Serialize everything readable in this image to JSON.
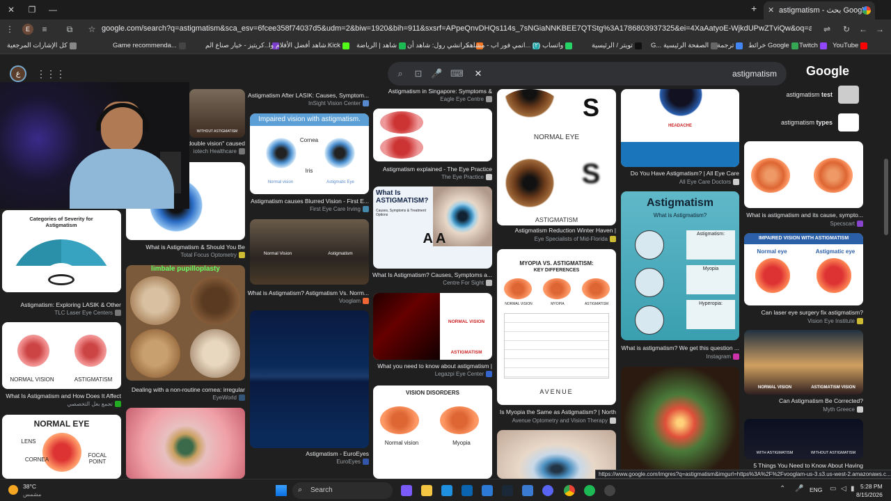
{
  "window": {
    "minimize": "—",
    "restore": "❐",
    "close": "✕"
  },
  "tab": {
    "title": "astigmatism - بحث Google",
    "close": "✕",
    "newtab": "+"
  },
  "toolbar": {
    "url": "google.com/search?q=astigmatism&sca_esv=6fcee358f74037d5&udm=2&biw=1920&bih=911&sxsrf=APpeQnvDHQs114s_7sNGiaNNKBEE7QTStg%3A1786803937325&ei=4XaAatyoE-WjkdUPwZTviQw&oq=asti&gs_lp=Egtnd3MtdGl6LWltZyIEYXN0aSo...",
    "profile": "E"
  },
  "bookmarks": [
    {
      "label": "كل الإشارات المرجعية",
      "color": "#888"
    },
    {
      "label": "Game recommenda...",
      "color": "#444"
    },
    {
      "label": "كريتيز - خيار صناع الم...",
      "color": "#7a3cc9"
    },
    {
      "label": "شاهد أفضل الأفلام وا...",
      "color": "#333"
    },
    {
      "label": "Kick",
      "color": "#53fc18"
    },
    {
      "label": "شاهد | الرياضة",
      "color": "#1db954"
    },
    {
      "label": "كرانشي رول: شاهد أن...",
      "color": "#f47521"
    },
    {
      "label": "انمي فور اب - مشاهد...",
      "color": "#2aa"
    },
    {
      "label": "واتساب (٢)",
      "color": "#25d366"
    },
    {
      "label": "تويتر / الرئيسية",
      "color": "#111"
    },
    {
      "label": "G... الصفحة الرئيسية",
      "color": "#666"
    },
    {
      "label": "ترجمة",
      "color": "#4285f4"
    },
    {
      "label": "خرائط Google",
      "color": "#34a853"
    },
    {
      "label": "Twitch",
      "color": "#9146ff"
    },
    {
      "label": "YouTube",
      "color": "#ff0000"
    }
  ],
  "search": {
    "query": "astigmatism",
    "logo": "Google",
    "avatar": "ع"
  },
  "results": {
    "c1": [
      {
        "cap": "Astigmatism: Exploring LASIK & Other",
        "src": "TLC Laser Eye Centers",
        "title": "Categories of Severity for Astigmatism"
      },
      {
        "cap": "What Is Astigmatism and How Does It Affect",
        "src": "تجمع بعل التخصصي",
        "l1": "NORMAL VISION",
        "l2": "ASTIGMATISM"
      },
      {
        "title": "NORMAL EYE",
        "l1": "LENS",
        "l2": "CORNEA",
        "l3": "FOCAL POINT"
      }
    ],
    "c2": [
      {
        "cap": "double vision\" caused",
        "src": "iotech Healthcare",
        "label": "WITHOUT ASTIGMATISM"
      },
      {
        "cap": "What is Astigmatism & Should You Be",
        "src": "Total Focus Optometry"
      },
      {
        "cap": "Dealing with a non-routine cornea: irregular",
        "src": "EyeWorld",
        "banner": "limbale pupilloplasty"
      }
    ],
    "c3": [
      {
        "cap": "Astigmatism After LASIK: Causes, Symptom...",
        "src": "InSight Vision Center"
      },
      {
        "cap": "Astigmatism causes Blurred Vision - First E...",
        "src": "First Eye Care Irving",
        "title": "Impaired vision with astigmatism.",
        "l1": "Cornea",
        "l2": "Iris",
        "l3": "Normal vision",
        "l4": "Astigmatic Eye"
      },
      {
        "cap": "What is Astigmatism? Astigmatism Vs. Norm...",
        "src": "Vooglam",
        "l1": "Normal Vision",
        "l2": "Astigmatism"
      },
      {
        "cap": "Astigmatism - EuroEyes",
        "src": "EuroEyes"
      }
    ],
    "c4": [
      {
        "cap": "Astigmatism in Singapore: Symptoms &",
        "src": "Eagle Eye Centre"
      },
      {
        "cap": "Astigmatism explained - The Eye Practice",
        "src": "The Eye Practice"
      },
      {
        "cap": "What Is Astigmatism? Causes, Symptoms a...",
        "src": "Centre For Sight",
        "title": "What Is ASTIGMATISM?",
        "sub": "Causes, Symptoms & Treatment Options",
        "aa": "A A"
      },
      {
        "cap": "What you need to know about astigmatism |",
        "src": "Legazpi Eye Center",
        "l1": "NORMAL VISION",
        "l2": "ASTIGMATISM"
      },
      {
        "title": "VISION DISORDERS",
        "l1": "Normal vision",
        "l2": "Myopia"
      }
    ],
    "c5": [
      {
        "cap": "Astigmatism Reduction Winter Haven |",
        "src": "Eye Specialists of Mid-Florida",
        "l1": "NORMAL EYE",
        "l2": "ASTIGMATISM"
      },
      {
        "cap": "Is Myopia the Same as Astigmatism? | North",
        "src": "Avenue Optometry and Vision Therapy",
        "title": "MYOPIA VS. ASTIGMATISM:",
        "sub": "KEY DIFFERENCES",
        "l1": "NORMAL VISION",
        "l2": "MYOPIA",
        "l3": "ASTIGMATISM",
        "brand": "AVENUE"
      }
    ],
    "c6": [
      {
        "cap": "Do You Have Astigmatism? | All Eye Care",
        "src": "All Eye Care Doctors",
        "l1": "HEADACHE"
      },
      {
        "cap": "What is astigmatism? We get this question ...",
        "src": "Instagram",
        "title": "Astigmatism",
        "sub": "What is Astigmatism?",
        "l1": "Astigmatism:",
        "l2": "Myopia",
        "l3": "Hyperopia:"
      }
    ],
    "c7": [
      {
        "cap": "What is astigmatism and its cause, sympto...",
        "src": "Specscart"
      },
      {
        "cap": "Can laser eye surgery fix astigmatism?",
        "src": "Vision Eye Institute",
        "title": "IMPAIRED VISION WITH ASTIGMATISM",
        "l1": "Normal eye",
        "l2": "Astigmatic eye"
      },
      {
        "cap": "Can Astigmatism Be Corrected?",
        "src": "Myth Greece",
        "l1": "NORMAL VISION",
        "l2": "ASTIGMATISM VISION"
      },
      {
        "cap": "5 Things You Need to Know About Having",
        "src": "",
        "l1": "WITH ASTIGMATISM",
        "l2": "WITHOUT ASTIGMATISM"
      }
    ],
    "related": [
      {
        "pre": "astigmatism ",
        "bold": "test"
      },
      {
        "pre": "astigmatism ",
        "bold": "types"
      }
    ]
  },
  "status_url": "https://www.google.com/imgres?q=astigmatism&imgurl=https%3A%2F%2Fvooglam-us-3.s3.us-west-2.amazonaws.c...",
  "taskbar": {
    "temp": "38°C",
    "weather": "مشمس",
    "search": "Search",
    "lang": "ENG",
    "time": "5:28 PM",
    "date": "8/15/2026"
  }
}
